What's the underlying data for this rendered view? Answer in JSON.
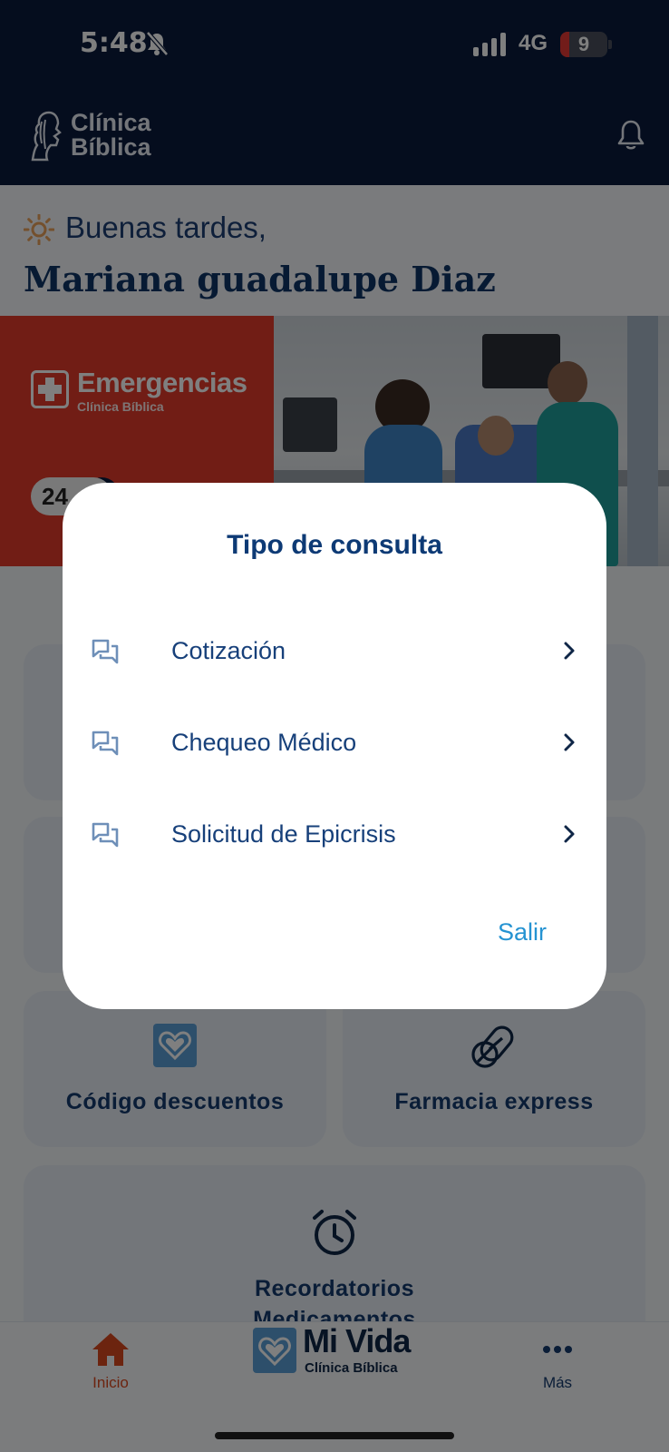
{
  "status_bar": {
    "time": "5:48",
    "network": "4G",
    "battery": "9"
  },
  "header": {
    "logo_line1": "Clínica",
    "logo_line2": "Bíblica"
  },
  "greeting": {
    "text": "Buenas tardes,",
    "name": "Mariana guadalupe Diaz"
  },
  "banner": {
    "title": "Emergencias",
    "subtitle": "Clínica Bíblica",
    "badge": "24"
  },
  "cards": [
    {
      "label": "Código descuentos",
      "icon": "heart-card-icon"
    },
    {
      "label": "Farmacia express",
      "icon": "pills-icon"
    },
    {
      "label": "Recordatorios",
      "label2": "Medicamentos",
      "icon": "alarm-clock-icon"
    }
  ],
  "bottom_nav": {
    "home": "Inicio",
    "center_brand": "Mi Vida",
    "center_sub": "Clínica Bíblica",
    "more": "Más"
  },
  "modal": {
    "title": "Tipo de consulta",
    "options": [
      {
        "label": "Cotización",
        "icon": "chat-icon"
      },
      {
        "label": "Chequeo Médico",
        "icon": "chat-icon"
      },
      {
        "label": "Solicitud de Epicrisis",
        "icon": "chat-icon"
      }
    ],
    "exit": "Salir"
  },
  "colors": {
    "navy": "#0a1a3d",
    "accent_red": "#e23a2a",
    "link_blue": "#2593d2",
    "text_blue": "#17407a",
    "home_active": "#d9481e"
  }
}
